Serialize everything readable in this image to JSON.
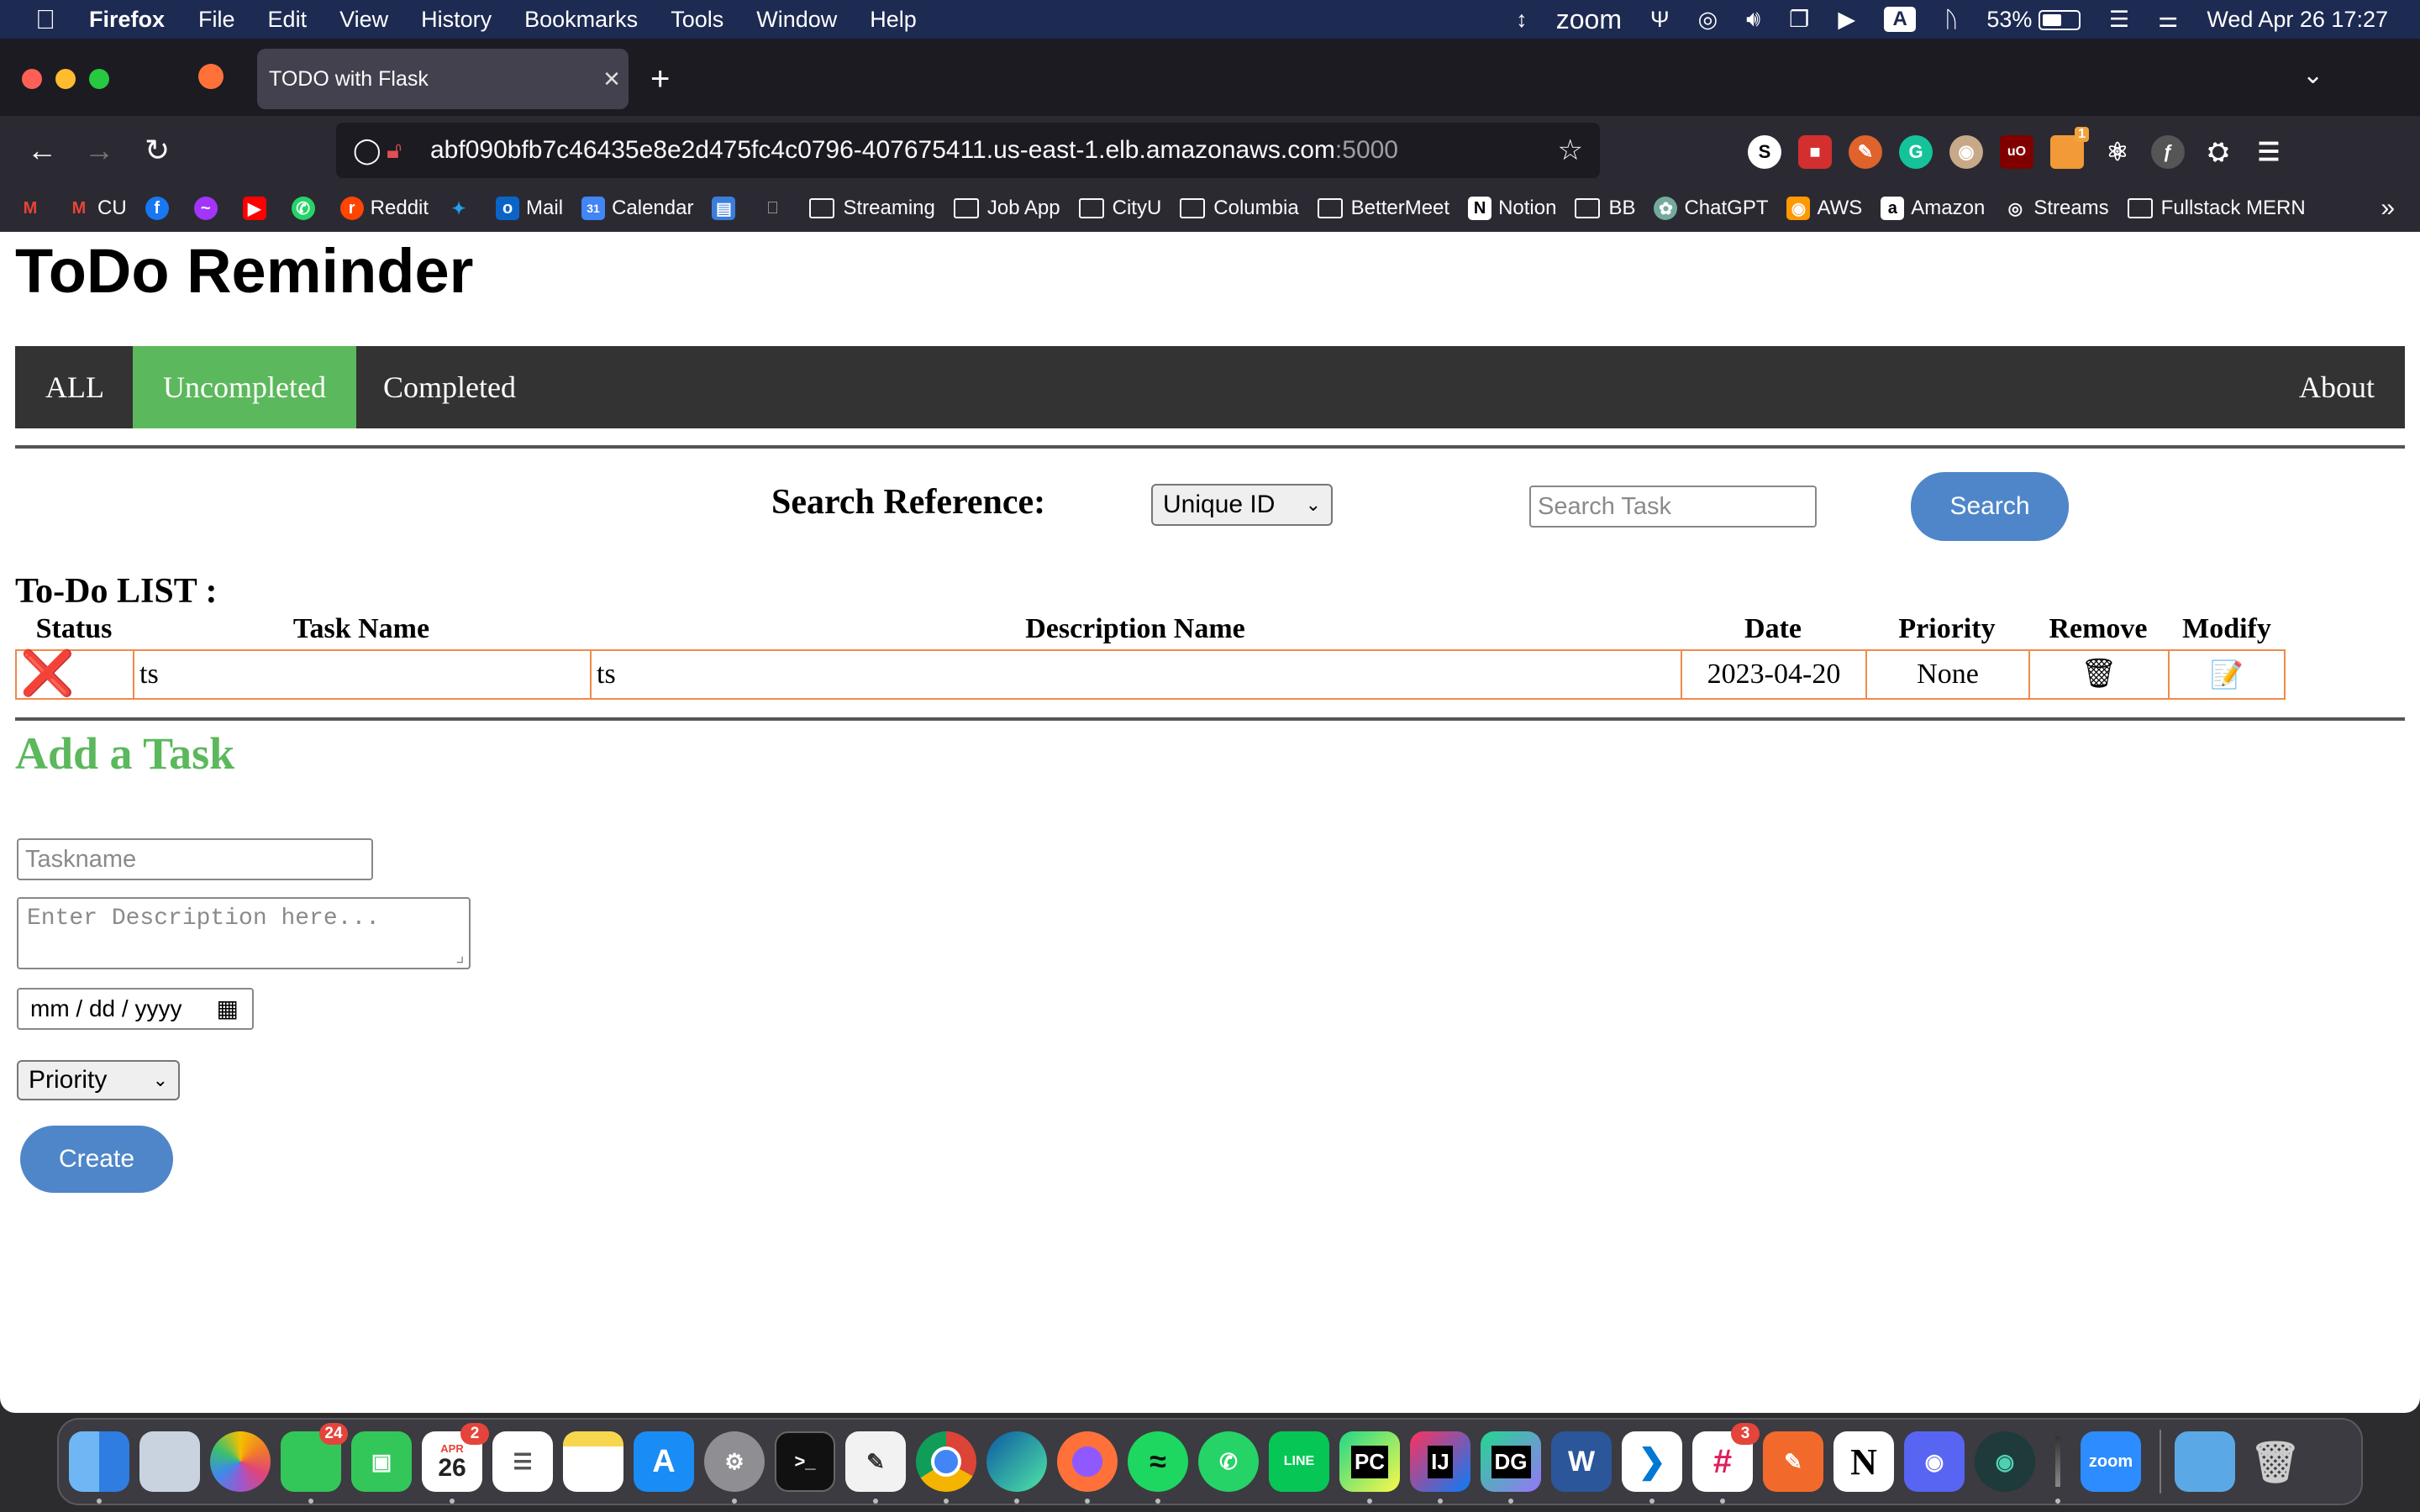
{
  "menubar": {
    "apple": "",
    "app_name": "Firefox",
    "menus": [
      "File",
      "Edit",
      "View",
      "History",
      "Bookmarks",
      "Tools",
      "Window",
      "Help"
    ],
    "zoom": "zoom",
    "battery": "53%",
    "input_source": "A",
    "datetime": "Wed Apr 26  17:27"
  },
  "browser": {
    "tab_title": "TODO with Flask",
    "url_host": "abf090bfb7c46435e8e2d475fc4c0796-407675411.us-east-1.elb.amazonaws.com",
    "url_port": ":5000",
    "extension_badge": "1",
    "bookmarks": [
      {
        "label": "",
        "icon": "gmail-icon"
      },
      {
        "label": "CU",
        "icon": "gmail-icon"
      },
      {
        "label": "",
        "icon": "facebook-icon"
      },
      {
        "label": "",
        "icon": "messenger-icon"
      },
      {
        "label": "",
        "icon": "youtube-icon"
      },
      {
        "label": "",
        "icon": "whatsapp-icon"
      },
      {
        "label": "Reddit",
        "icon": "reddit-icon"
      },
      {
        "label": "",
        "icon": "twitter-icon"
      },
      {
        "label": "Mail",
        "icon": "outlook-icon"
      },
      {
        "label": "Calendar",
        "icon": "calendar-icon"
      },
      {
        "label": "",
        "icon": "bookmark-icon"
      },
      {
        "label": "",
        "icon": "apple-icon"
      },
      {
        "label": "Streaming",
        "icon": "folder-icon"
      },
      {
        "label": "Job App",
        "icon": "folder-icon"
      },
      {
        "label": "CityU",
        "icon": "folder-icon"
      },
      {
        "label": "Columbia",
        "icon": "folder-icon"
      },
      {
        "label": "BetterMeet",
        "icon": "folder-icon"
      },
      {
        "label": "Notion",
        "icon": "notion-icon"
      },
      {
        "label": "BB",
        "icon": "folder-icon"
      },
      {
        "label": "ChatGPT",
        "icon": "chatgpt-icon"
      },
      {
        "label": "AWS",
        "icon": "aws-icon"
      },
      {
        "label": "Amazon",
        "icon": "amazon-icon"
      },
      {
        "label": "Streams",
        "icon": "globe-icon"
      },
      {
        "label": "Fullstack MERN",
        "icon": "folder-icon"
      }
    ]
  },
  "page": {
    "title": "ToDo Reminder",
    "nav": {
      "all": "ALL",
      "uncompleted": "Uncompleted",
      "completed": "Completed",
      "about": "About",
      "active": "Uncompleted"
    },
    "search": {
      "label": "Search Reference:",
      "reference_selected": "Unique ID",
      "placeholder": "Search Task",
      "button": "Search"
    },
    "list": {
      "title": "To-Do LIST :",
      "columns": [
        "Status",
        "Task Name",
        "Description Name",
        "Date",
        "Priority",
        "Remove",
        "Modify"
      ],
      "rows": [
        {
          "status": "❌",
          "task_name": "ts",
          "description": "ts",
          "date": "2023-04-20",
          "priority": "None",
          "remove": "🗑",
          "modify": "📝"
        }
      ]
    },
    "add_task": {
      "title": "Add a Task",
      "taskname_placeholder": "Taskname",
      "description_placeholder": "Enter Description here...",
      "date_placeholder": "mm / dd / yyyy",
      "priority_selected": "Priority",
      "create_button": "Create"
    }
  },
  "dock": {
    "apps": [
      {
        "name": "finder",
        "label": ""
      },
      {
        "name": "preview",
        "label": ""
      },
      {
        "name": "photos",
        "label": ""
      },
      {
        "name": "messages",
        "label": "",
        "badge": "24"
      },
      {
        "name": "facetime",
        "label": ""
      },
      {
        "name": "calendar",
        "label": "26",
        "month": "APR",
        "badge": "2"
      },
      {
        "name": "reminders",
        "label": ""
      },
      {
        "name": "notes",
        "label": ""
      },
      {
        "name": "app-store",
        "label": "A"
      },
      {
        "name": "system-settings",
        "label": ""
      },
      {
        "name": "terminal",
        "label": ">_"
      },
      {
        "name": "textedit",
        "label": ""
      },
      {
        "name": "chrome",
        "label": ""
      },
      {
        "name": "edge",
        "label": ""
      },
      {
        "name": "firefox",
        "label": ""
      },
      {
        "name": "spotify",
        "label": ""
      },
      {
        "name": "whatsapp",
        "label": ""
      },
      {
        "name": "line",
        "label": "LINE"
      },
      {
        "name": "pycharm",
        "label": "PC"
      },
      {
        "name": "intellij",
        "label": "IJ"
      },
      {
        "name": "datagrip",
        "label": "DG"
      },
      {
        "name": "word",
        "label": "W"
      },
      {
        "name": "vscode",
        "label": ""
      },
      {
        "name": "slack",
        "label": "",
        "badge": "3"
      },
      {
        "name": "pen-app",
        "label": ""
      },
      {
        "name": "notion",
        "label": "N"
      },
      {
        "name": "discord",
        "label": ""
      },
      {
        "name": "gitkraken",
        "label": ""
      },
      {
        "name": "audio-meter",
        "label": ""
      },
      {
        "name": "zoom",
        "label": "zoom"
      },
      {
        "name": "downloads-folder",
        "label": ""
      },
      {
        "name": "trash",
        "label": ""
      }
    ]
  }
}
